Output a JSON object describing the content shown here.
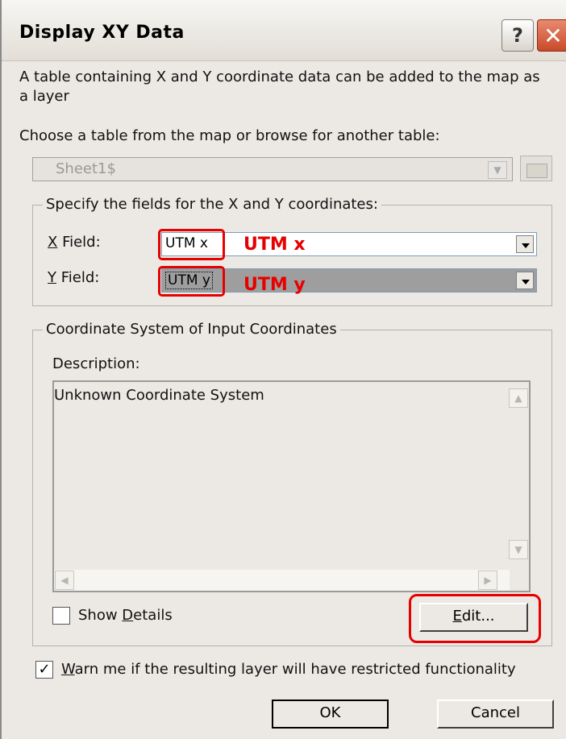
{
  "window": {
    "title": "Display XY Data",
    "help_label": "?",
    "close_label": "✕"
  },
  "intro_text": "A table containing X and Y coordinate data can be added to the map as a layer",
  "choose_label": "Choose a table from the map or browse for another table:",
  "table_combo": {
    "value": "Sheet1$"
  },
  "fields_group": {
    "title": "Specify the fields for the X and Y coordinates:",
    "x_label_mnemonic": "X",
    "x_label_rest": " Field:",
    "x_value": "UTM x",
    "y_label_mnemonic": "Y",
    "y_label_rest": " Field:",
    "y_value": "UTM y"
  },
  "annotations": {
    "x_note": "UTM x",
    "y_note": "UTM y"
  },
  "coord_group": {
    "title": "Coordinate System of Input Coordinates",
    "description_label": "Description:",
    "description_text": "Unknown Coordinate System",
    "show_details_prefix": "Show ",
    "show_details_mnemonic": "D",
    "show_details_rest": "etails",
    "show_details_checked": false,
    "edit_mnemonic": "E",
    "edit_rest": "dit..."
  },
  "warn": {
    "checked": true,
    "check_mark": "✓",
    "mnemonic": "W",
    "rest": "arn me if the resulting layer will have restricted functionality"
  },
  "buttons": {
    "ok": "OK",
    "cancel": "Cancel"
  },
  "colors": {
    "dialog_bg": "#ECE9E4",
    "annotation_red": "#E60000"
  },
  "icons": [
    "help-icon",
    "close-icon",
    "folder-icon",
    "dropdown-arrow-icon",
    "scroll-arrow-icon",
    "checkmark-icon"
  ]
}
